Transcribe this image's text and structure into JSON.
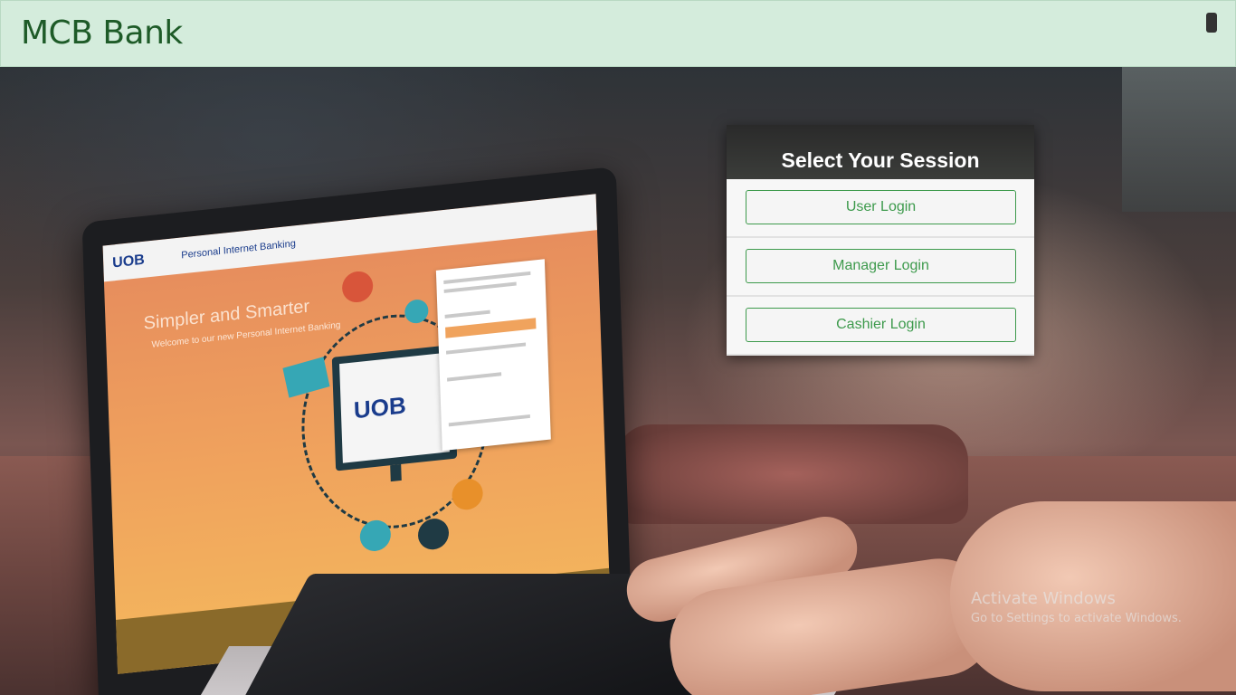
{
  "navbar": {
    "brand": "MCB Bank"
  },
  "session": {
    "title": "Select Your Session",
    "buttons": [
      {
        "label": "User Login"
      },
      {
        "label": "Manager Login"
      },
      {
        "label": "Cashier Login"
      }
    ]
  },
  "hero_screen": {
    "header_text": "Personal Internet Banking",
    "logo_small": "UOB",
    "headline": "Simpler and Smarter",
    "subline": "Welcome to our new Personal Internet Banking",
    "monitor_logo": "UOB"
  },
  "watermark": {
    "title": "Activate Windows",
    "subtitle": "Go to Settings to activate Windows."
  },
  "colors": {
    "navbar_bg": "#d4ecdc",
    "brand_text": "#1e5b28",
    "accent_green": "#3d9a4c",
    "panel_header": "#2a2a2a"
  }
}
